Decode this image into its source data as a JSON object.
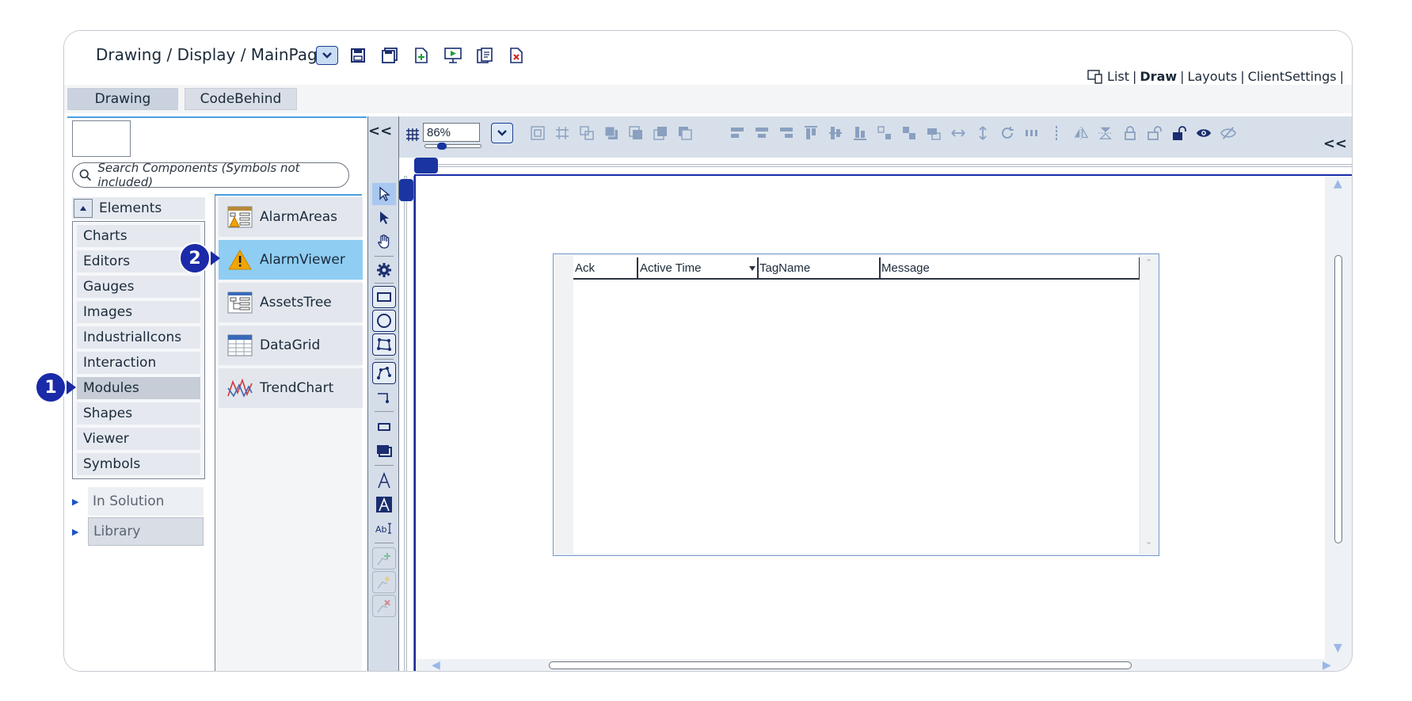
{
  "title": "Drawing / Display / MainPage",
  "top_links": {
    "list": "List",
    "draw": "Draw",
    "layouts": "Layouts",
    "client_settings": "ClientSettings",
    "sep": "|"
  },
  "tabs": [
    {
      "label": "Drawing"
    },
    {
      "label": "CodeBehind"
    }
  ],
  "search": {
    "placeholder": "Search Components (Symbols not included)"
  },
  "elements_header": "Elements",
  "categories": [
    "Charts",
    "Editors",
    "Gauges",
    "Images",
    "IndustrialIcons",
    "Interaction",
    "Modules",
    "Shapes",
    "Viewer",
    "Symbols"
  ],
  "selected_category": "Modules",
  "tree": {
    "in_solution": "In Solution",
    "library": "Library"
  },
  "components": [
    "AlarmAreas",
    "AlarmViewer",
    "AssetsTree",
    "DataGrid",
    "TrendChart"
  ],
  "selected_component": "AlarmViewer",
  "badges": {
    "one": "1",
    "two": "2"
  },
  "collapse_left": "<<",
  "collapse_right": "<<",
  "zoom": {
    "value": "86%",
    "slider_fraction": 0.25
  },
  "alarm_viewer": {
    "columns": [
      "Ack",
      "Active Time",
      "TagName",
      "Message"
    ]
  },
  "colors": {
    "accent": "#1a2aa8",
    "selection": "#8fcdf3",
    "toolbar": "#d7e0ea"
  }
}
